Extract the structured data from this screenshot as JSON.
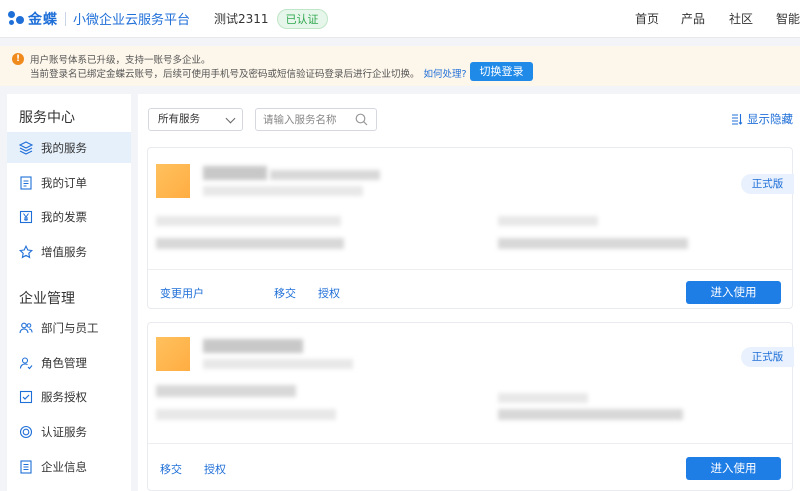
{
  "header": {
    "logo_text": "金蝶",
    "platform_name": "小微企业云服务平台",
    "tenant_name": "测试2311",
    "verified_label": "已认证",
    "nav": [
      "首页",
      "产品",
      "社区",
      "智能"
    ]
  },
  "notice": {
    "icon": "exclamation-icon",
    "line1": "用户账号体系已升级，支持一账号多企业。",
    "line2": "当前登录名已绑定金蝶云账号，后续可使用手机号及密码或短信验证码登录后进行企业切换。",
    "help_link": "如何处理?",
    "switch_button": "切换登录"
  },
  "sidebar": {
    "sections": [
      {
        "title": "服务中心",
        "items": [
          {
            "label": "我的服务",
            "icon": "layers-icon",
            "active": true
          },
          {
            "label": "我的订单",
            "icon": "document-icon"
          },
          {
            "label": "我的发票",
            "icon": "yuan-icon"
          },
          {
            "label": "增值服务",
            "icon": "star-icon"
          }
        ]
      },
      {
        "title": "企业管理",
        "items": [
          {
            "label": "部门与员工",
            "icon": "users-icon"
          },
          {
            "label": "角色管理",
            "icon": "role-icon"
          },
          {
            "label": "服务授权",
            "icon": "authorize-icon"
          },
          {
            "label": "认证服务",
            "icon": "certify-icon"
          },
          {
            "label": "企业信息",
            "icon": "info-icon"
          }
        ]
      }
    ]
  },
  "main": {
    "filter_select": "所有服务",
    "search_placeholder": "请输入服务名称",
    "toggle_hidden": "显示隐藏",
    "cards": [
      {
        "badge": "正式版",
        "links": [
          "变更用户",
          "移交",
          "授权"
        ],
        "enter_button": "进入使用"
      },
      {
        "badge": "正式版",
        "links": [
          "移交",
          "授权"
        ],
        "enter_button": "进入使用"
      }
    ]
  },
  "colors": {
    "brand": "#1f6fd8",
    "primary_button": "#1f7de6",
    "notice_bg": "#fdf6ea",
    "warning": "#f08a1c",
    "verified": "#2fa84f"
  }
}
